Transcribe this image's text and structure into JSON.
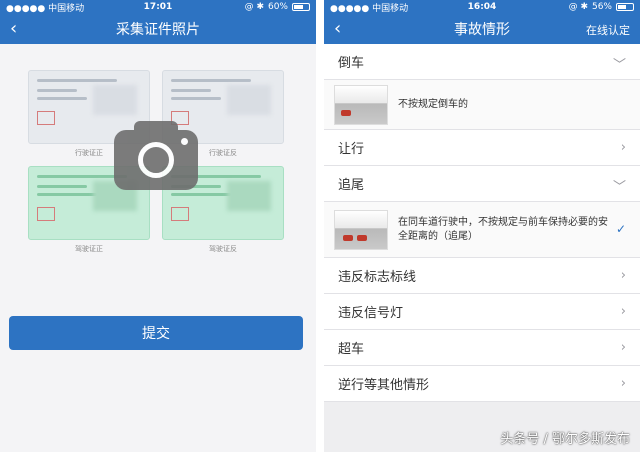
{
  "left": {
    "status": {
      "carrier": "●●●●● 中国移动",
      "time": "17:01",
      "right": "@ ✱",
      "battery": "60%",
      "battery_level": 0.6
    },
    "title": "采集证件照片",
    "cards": [
      {
        "heading": "中华人民共和国机动车行驶证",
        "caption": "行驶证正",
        "color": "gray"
      },
      {
        "heading": "中华人民共和国机动车行驶证",
        "caption": "行驶证反",
        "color": "gray"
      },
      {
        "heading": "中华人民共和国机动车驾驶证",
        "caption": "驾驶证正",
        "color": "green"
      },
      {
        "heading": "中华人民共和国机动车驾驶证",
        "caption": "驾驶证反",
        "color": "green"
      }
    ],
    "submit_label": "提交"
  },
  "right": {
    "status": {
      "carrier": "●●●●● 中国移动",
      "time": "16:04",
      "right": "@ ✱",
      "battery": "56%",
      "battery_level": 0.56
    },
    "title": "事故情形",
    "online_action": "在线认定",
    "items": [
      {
        "label": "倒车",
        "expanded": true,
        "sub": "不按规定倒车的"
      },
      {
        "label": "让行",
        "expanded": false
      },
      {
        "label": "追尾",
        "expanded": true,
        "sub": "在同车道行驶中，不按规定与前车保持必要的安全距离的（追尾）",
        "checked": true
      },
      {
        "label": "违反标志标线",
        "expanded": false
      },
      {
        "label": "违反信号灯",
        "expanded": false
      },
      {
        "label": "超车",
        "expanded": false
      },
      {
        "label": "逆行等其他情形",
        "expanded": false
      }
    ]
  },
  "watermark": "头条号 / 鄂尔多斯发布"
}
